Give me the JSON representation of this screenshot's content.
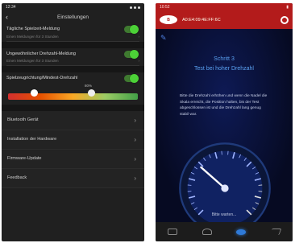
{
  "left": {
    "status_time": "12:34",
    "title": "Einstellungen",
    "toggles": [
      {
        "label": "Tägliche Spielzeit-Meldung",
        "sub": "Einen Meldungen für 3 Stunden",
        "on": true
      },
      {
        "label": "Ungewöhnlicher Drehzahl-Meldung",
        "sub": "Einen Meldungen für 3 Stunden",
        "on": true
      },
      {
        "label": "Spielzeugrichtung/Mindest-Drehzahl",
        "sub": "",
        "on": true
      }
    ],
    "slider_value_label": "80%",
    "slider_level": 0.62,
    "menu": [
      {
        "label": "Bluetooth Gerät"
      },
      {
        "label": "Installation der Hardware"
      },
      {
        "label": "Firmware-Update"
      },
      {
        "label": "Feedback"
      }
    ]
  },
  "right": {
    "status_time": "10:52",
    "logo_text": "B",
    "device_id": "A0:E4:09:4E:FF:6C",
    "step": "Schritt 3",
    "step_title": "Test bei hoher Drehzahl",
    "description": "Bitte die Drehzahl erhöhen und wenn die Nadel die Skala erreicht, die Position halten, bis der Test abgeschlossen ist und die Drehzahl lang genug stabil war.",
    "gauge_value": 0.32,
    "waiting_text": "Bitte warten...",
    "accent_color": "#5aa0f0",
    "header_color": "#b31b1b"
  }
}
